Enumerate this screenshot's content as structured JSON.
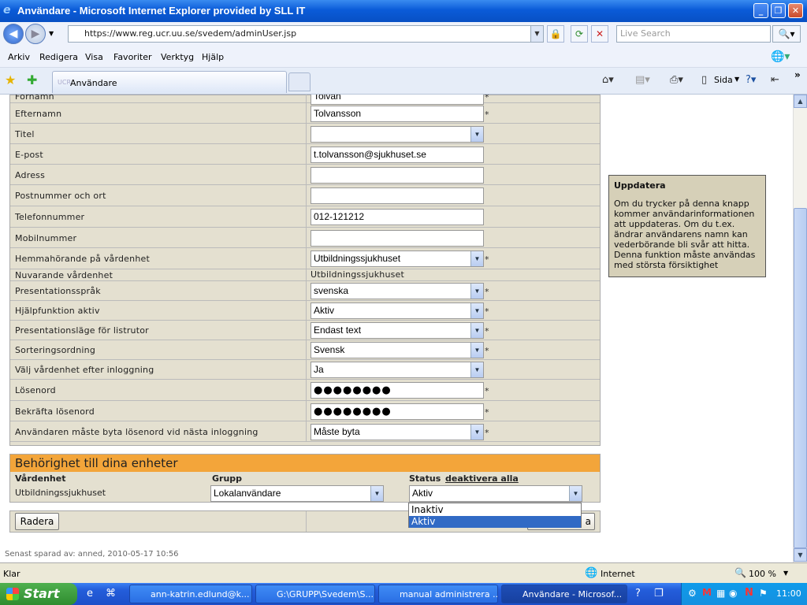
{
  "window": {
    "title": "Användare - Microsoft Internet Explorer provided by SLL IT"
  },
  "address_bar": {
    "url": "https://www.reg.ucr.uu.se/svedem/adminUser.jsp",
    "search_placeholder": "Live Search"
  },
  "menu": [
    "Arkiv",
    "Redigera",
    "Visa",
    "Favoriter",
    "Verktyg",
    "Hjälp"
  ],
  "tab": {
    "label": "Användare"
  },
  "toolbar_right": {
    "page_label": "Sida"
  },
  "form": {
    "rows": [
      {
        "label": "Förnamn",
        "value": "Tolvan",
        "type": "text",
        "required": true
      },
      {
        "label": "Efternamn",
        "value": "Tolvansson",
        "type": "text",
        "required": true
      },
      {
        "label": "Titel",
        "value": "",
        "type": "select",
        "required": false
      },
      {
        "label": "E-post",
        "value": "t.tolvansson@sjukhuset.se",
        "type": "text",
        "required": false
      },
      {
        "label": "Adress",
        "value": "",
        "type": "text",
        "required": false
      },
      {
        "label": "Postnummer och ort",
        "value": "",
        "type": "text",
        "required": false
      },
      {
        "label": "Telefonnummer",
        "value": "012-121212",
        "type": "text",
        "required": false
      },
      {
        "label": "Mobilnummer",
        "value": "",
        "type": "text",
        "required": false
      },
      {
        "label": "Hemmahörande på vårdenhet",
        "value": "Utbildningssjukhuset",
        "type": "select",
        "required": true
      },
      {
        "label": "Nuvarande vårdenhet",
        "value": "Utbildningssjukhuset",
        "type": "static",
        "required": false
      },
      {
        "label": "Presentationsspråk",
        "value": "svenska",
        "type": "select",
        "required": true
      },
      {
        "label": "Hjälpfunktion aktiv",
        "value": "Aktiv",
        "type": "select",
        "required": true
      },
      {
        "label": "Presentationsläge för listrutor",
        "value": "Endast text",
        "type": "select",
        "required": true
      },
      {
        "label": "Sorteringsordning",
        "value": "Svensk",
        "type": "select",
        "required": true
      },
      {
        "label": "Välj vårdenhet efter inloggning",
        "value": "Ja",
        "type": "select",
        "required": false
      },
      {
        "label": "Lösenord",
        "value": "●●●●●●●●",
        "type": "password",
        "required": true
      },
      {
        "label": "Bekräfta lösenord",
        "value": "●●●●●●●●",
        "type": "password",
        "required": true
      },
      {
        "label": "Användaren måste byta lösenord vid nästa inloggning",
        "value": "Måste byta",
        "type": "select",
        "required": true
      }
    ],
    "required_mark": "*"
  },
  "help_box": {
    "title": "Uppdatera",
    "text": "Om du trycker på denna knapp kommer användarinformationen att uppdateras. Om du t.ex. ändrar användarens namn kan vederbörande bli svår att hitta. Denna funktion måste användas med största försiktighet"
  },
  "permissions": {
    "header": "Behörighet till dina enheter",
    "col_unit": "Vårdenhet",
    "col_group": "Grupp",
    "col_status": "Status",
    "deactivate_link": "deaktivera alla",
    "row": {
      "unit": "Utbildningssjukhuset",
      "group": "Lokalanvändare",
      "status": "Aktiv"
    }
  },
  "status_dropdown": {
    "options": [
      "Inaktiv",
      "Aktiv"
    ],
    "selected": "Aktiv"
  },
  "buttons": {
    "delete": "Radera",
    "update_partial": "a"
  },
  "footer": "Senast sparad av: anned, 2010-05-17 10:56",
  "statusbar": {
    "left": "Klar",
    "zone": "Internet",
    "zoom": "100 %"
  },
  "taskbar": {
    "start": "Start",
    "tasks": [
      "ann-katrin.edlund@k...",
      "G:\\GRUPP\\Svedem\\S...",
      "manual administrera ...",
      "Användare - Microsof..."
    ],
    "clock": "11:00"
  }
}
